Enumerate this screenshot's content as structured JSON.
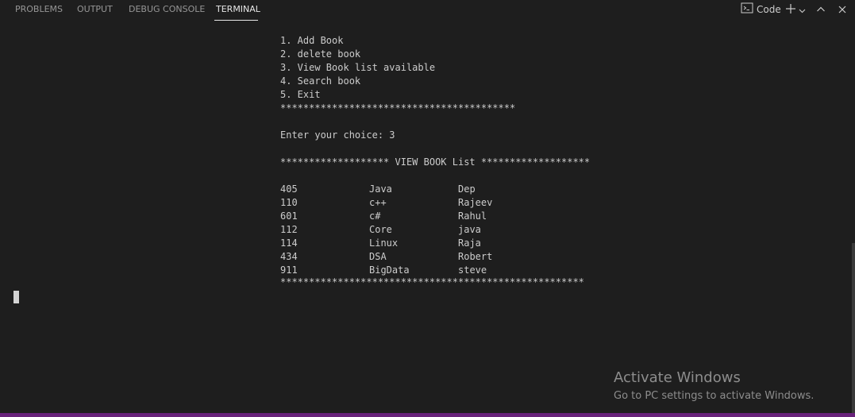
{
  "tabs": {
    "problems": "PROBLEMS",
    "output": "OUTPUT",
    "debug_console": "DEBUG CONSOLE",
    "terminal": "TERMINAL"
  },
  "toolbar": {
    "shell_label": "Code"
  },
  "terminal": {
    "menu": [
      "1. Add Book",
      "2. delete book",
      "3. View Book list available",
      "4. Search book",
      "5. Exit"
    ],
    "separator_short": "*****************************************",
    "prompt": "Enter your choice: 3",
    "view_header": "******************* VIEW BOOK List *******************",
    "books": [
      {
        "id": "405",
        "title": "Java",
        "author": "Dep"
      },
      {
        "id": "110",
        "title": "c++",
        "author": "Rajeev"
      },
      {
        "id": "601",
        "title": "c#",
        "author": "Rahul"
      },
      {
        "id": "112",
        "title": "Core",
        "author": "java"
      },
      {
        "id": "114",
        "title": "Linux",
        "author": "Raja"
      },
      {
        "id": "434",
        "title": "DSA",
        "author": "Robert"
      },
      {
        "id": "911",
        "title": "BigData",
        "author": "steve"
      }
    ],
    "separator_long": "*****************************************************"
  },
  "watermark": {
    "title": "Activate Windows",
    "subtitle": "Go to PC settings to activate Windows."
  },
  "colors": {
    "background": "#1e1e1e",
    "text": "#cccccc",
    "status_bar": "#68217a"
  }
}
